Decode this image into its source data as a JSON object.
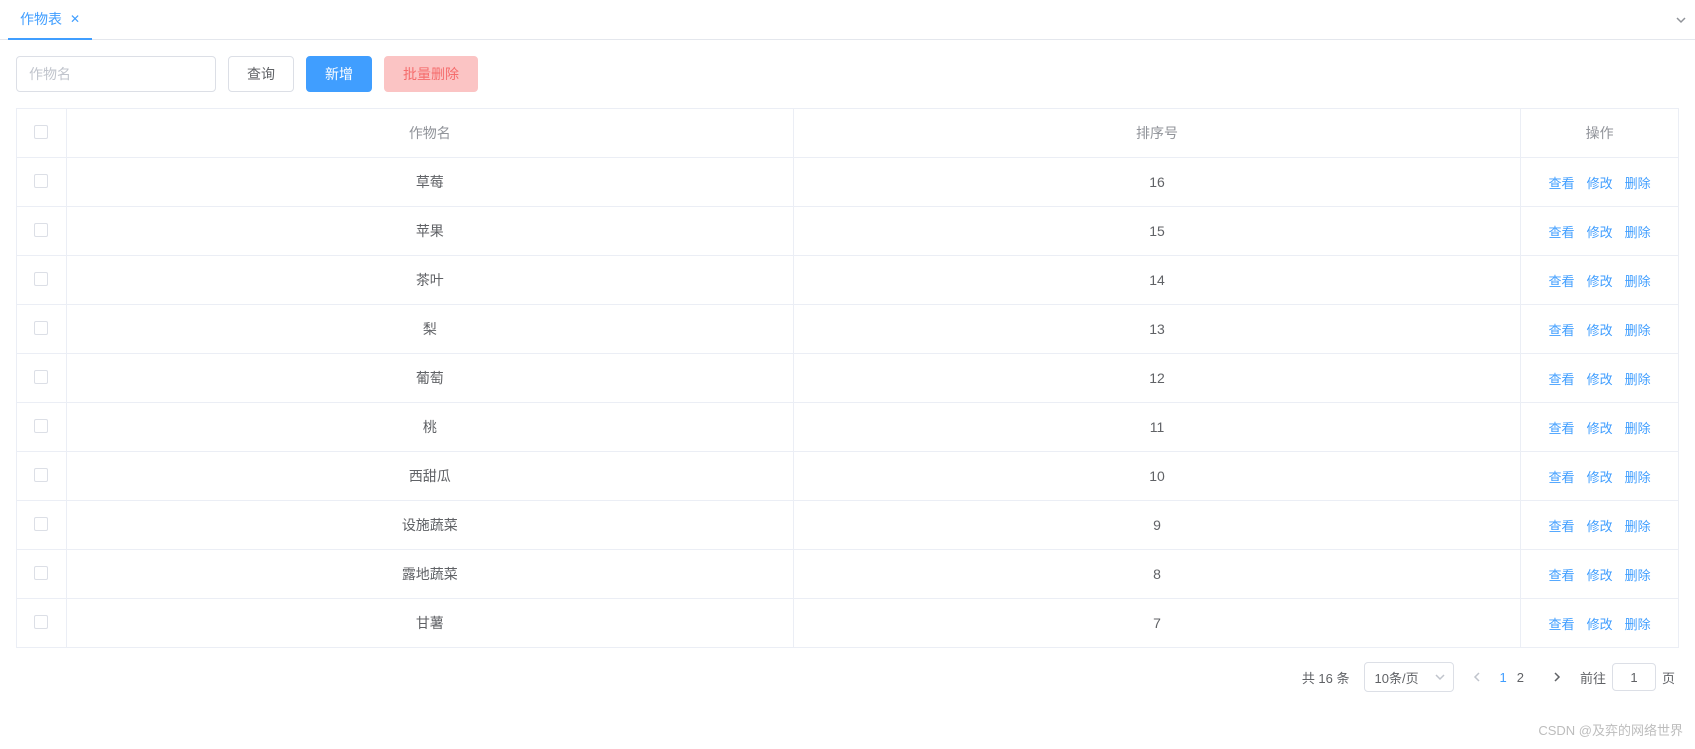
{
  "tabs": {
    "active": "作物表"
  },
  "toolbar": {
    "search_placeholder": "作物名",
    "search_label": "查询",
    "add_label": "新增",
    "batch_delete_label": "批量删除"
  },
  "table": {
    "headers": {
      "name": "作物名",
      "sort": "排序号",
      "ops": "操作"
    },
    "ops": {
      "view": "查看",
      "edit": "修改",
      "delete": "删除"
    },
    "rows": [
      {
        "name": "草莓",
        "sort": "16"
      },
      {
        "name": "苹果",
        "sort": "15"
      },
      {
        "name": "茶叶",
        "sort": "14"
      },
      {
        "name": "梨",
        "sort": "13"
      },
      {
        "name": "葡萄",
        "sort": "12"
      },
      {
        "name": "桃",
        "sort": "11"
      },
      {
        "name": "西甜瓜",
        "sort": "10"
      },
      {
        "name": "设施蔬菜",
        "sort": "9"
      },
      {
        "name": "露地蔬菜",
        "sort": "8"
      },
      {
        "name": "甘薯",
        "sort": "7"
      }
    ]
  },
  "pagination": {
    "total_text": "共 16 条",
    "page_size": "10条/页",
    "pages": [
      "1",
      "2"
    ],
    "current": "1",
    "goto_prefix": "前往",
    "goto_value": "1",
    "goto_suffix": "页"
  },
  "watermark": "CSDN @及弈的网络世界"
}
